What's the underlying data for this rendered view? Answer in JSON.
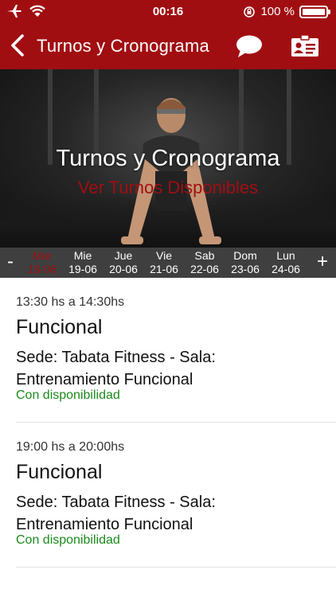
{
  "status_bar": {
    "time": "00:16",
    "battery": "100 %"
  },
  "nav": {
    "title": "Turnos y Cronograma"
  },
  "hero": {
    "title": "Turnos y Cronograma",
    "subtitle": "Ver Turnos Disponibles"
  },
  "days": [
    {
      "name": "Mar",
      "date": "18-06",
      "active": true
    },
    {
      "name": "Mie",
      "date": "19-06",
      "active": false
    },
    {
      "name": "Jue",
      "date": "20-06",
      "active": false
    },
    {
      "name": "Vie",
      "date": "21-06",
      "active": false
    },
    {
      "name": "Sab",
      "date": "22-06",
      "active": false
    },
    {
      "name": "Dom",
      "date": "23-06",
      "active": false
    },
    {
      "name": "Lun",
      "date": "24-06",
      "active": false
    }
  ],
  "day_nav": {
    "prev": "-",
    "next": "+"
  },
  "sessions": [
    {
      "time": "13:30 hs a 14:30hs",
      "class": "Funcional",
      "location": "Sede: Tabata Fitness - Sala: Entrenamiento Funcional",
      "availability": "Con disponibilidad"
    },
    {
      "time": "19:00 hs a 20:00hs",
      "class": "Funcional",
      "location": "Sede: Tabata Fitness - Sala: Entrenamiento Funcional",
      "availability": "Con disponibilidad"
    }
  ],
  "colors": {
    "brand": "#a10e12",
    "available": "#1b8a1b",
    "day_strip": "#3f3f3f"
  },
  "icons": [
    "airplane-icon",
    "wifi-icon",
    "rotation-lock-icon",
    "battery-icon",
    "back-chevron-icon",
    "chat-bubble-icon",
    "contact-card-icon"
  ]
}
